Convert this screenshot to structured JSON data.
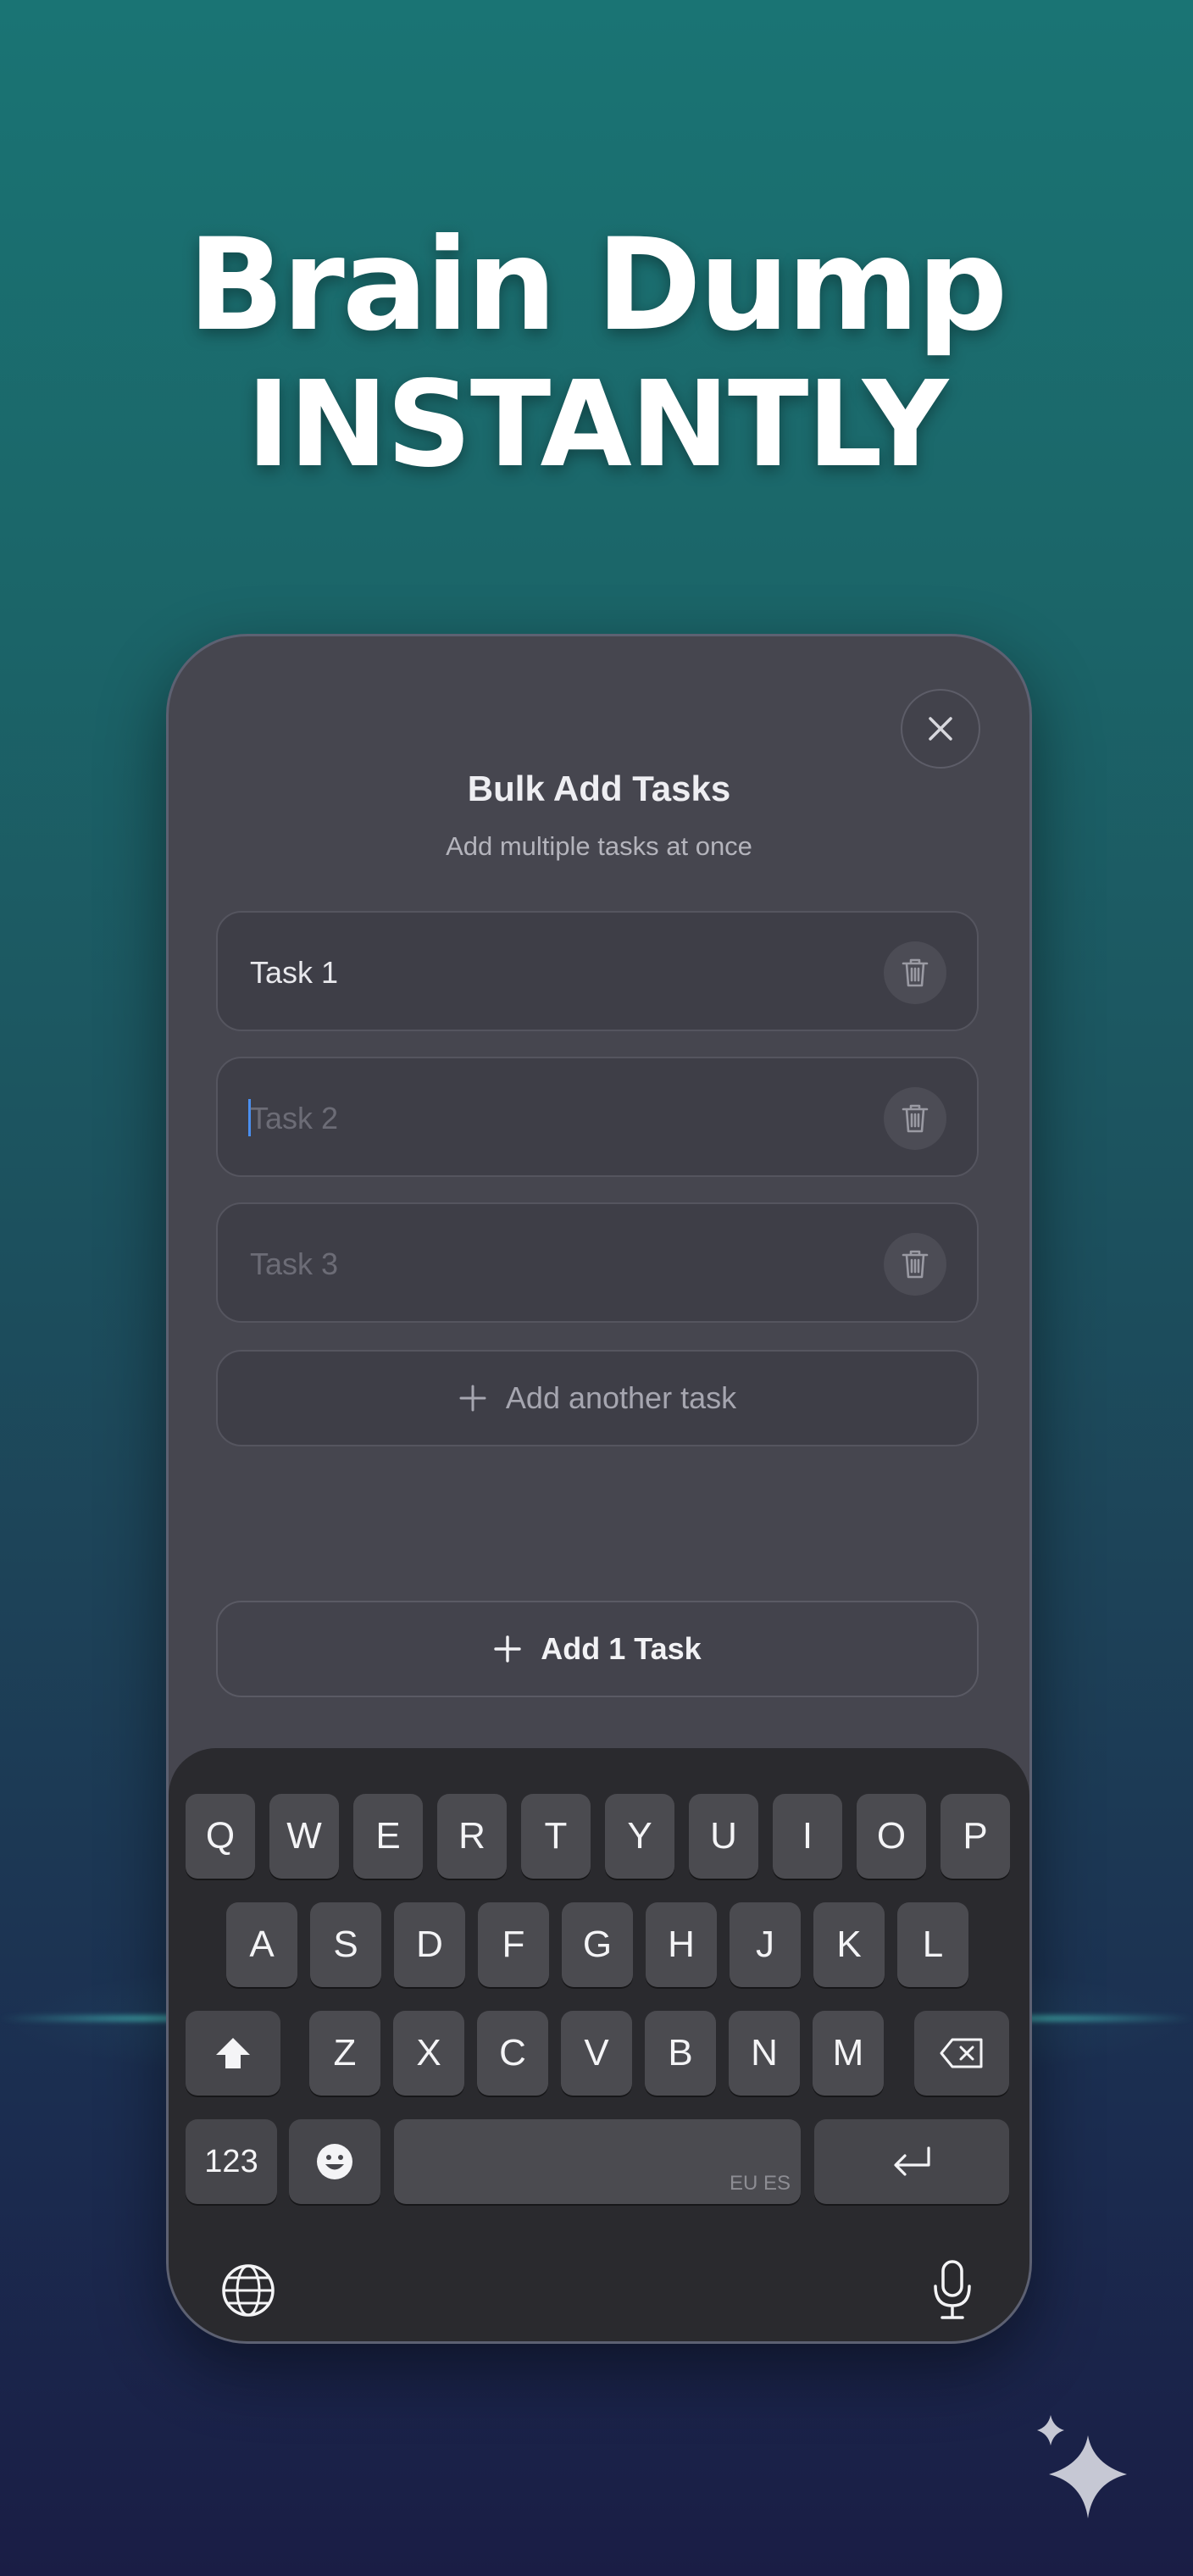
{
  "headline": {
    "line1": "Brain Dump",
    "line2": "INSTANTLY"
  },
  "sheet": {
    "title": "Bulk Add Tasks",
    "subtitle": "Add multiple tasks at once",
    "tasks": [
      {
        "value": "Task 1",
        "placeholder": "",
        "focused": false
      },
      {
        "value": "",
        "placeholder": "Task 2",
        "focused": true
      },
      {
        "value": "",
        "placeholder": "Task 3",
        "focused": false
      }
    ],
    "add_another_label": "Add another task",
    "submit_label": "Add 1 Task"
  },
  "keyboard": {
    "row1": [
      "Q",
      "W",
      "E",
      "R",
      "T",
      "Y",
      "U",
      "I",
      "O",
      "P"
    ],
    "row2": [
      "A",
      "S",
      "D",
      "F",
      "G",
      "H",
      "J",
      "K",
      "L"
    ],
    "row3": [
      "Z",
      "X",
      "C",
      "V",
      "B",
      "N",
      "M"
    ],
    "numbers_label": "123",
    "space_hint": "EU ES"
  },
  "icons": {
    "close": "close-icon",
    "trash": "trash-icon",
    "plus": "plus-icon",
    "shift": "shift-icon",
    "backspace": "backspace-icon",
    "emoji": "emoji-icon",
    "return": "return-icon",
    "globe": "globe-icon",
    "mic": "microphone-icon",
    "sparkle": "sparkle-icon"
  },
  "colors": {
    "caret": "#4a8ff0",
    "background_top": "#1a7474",
    "background_bottom": "#1a1d45"
  }
}
